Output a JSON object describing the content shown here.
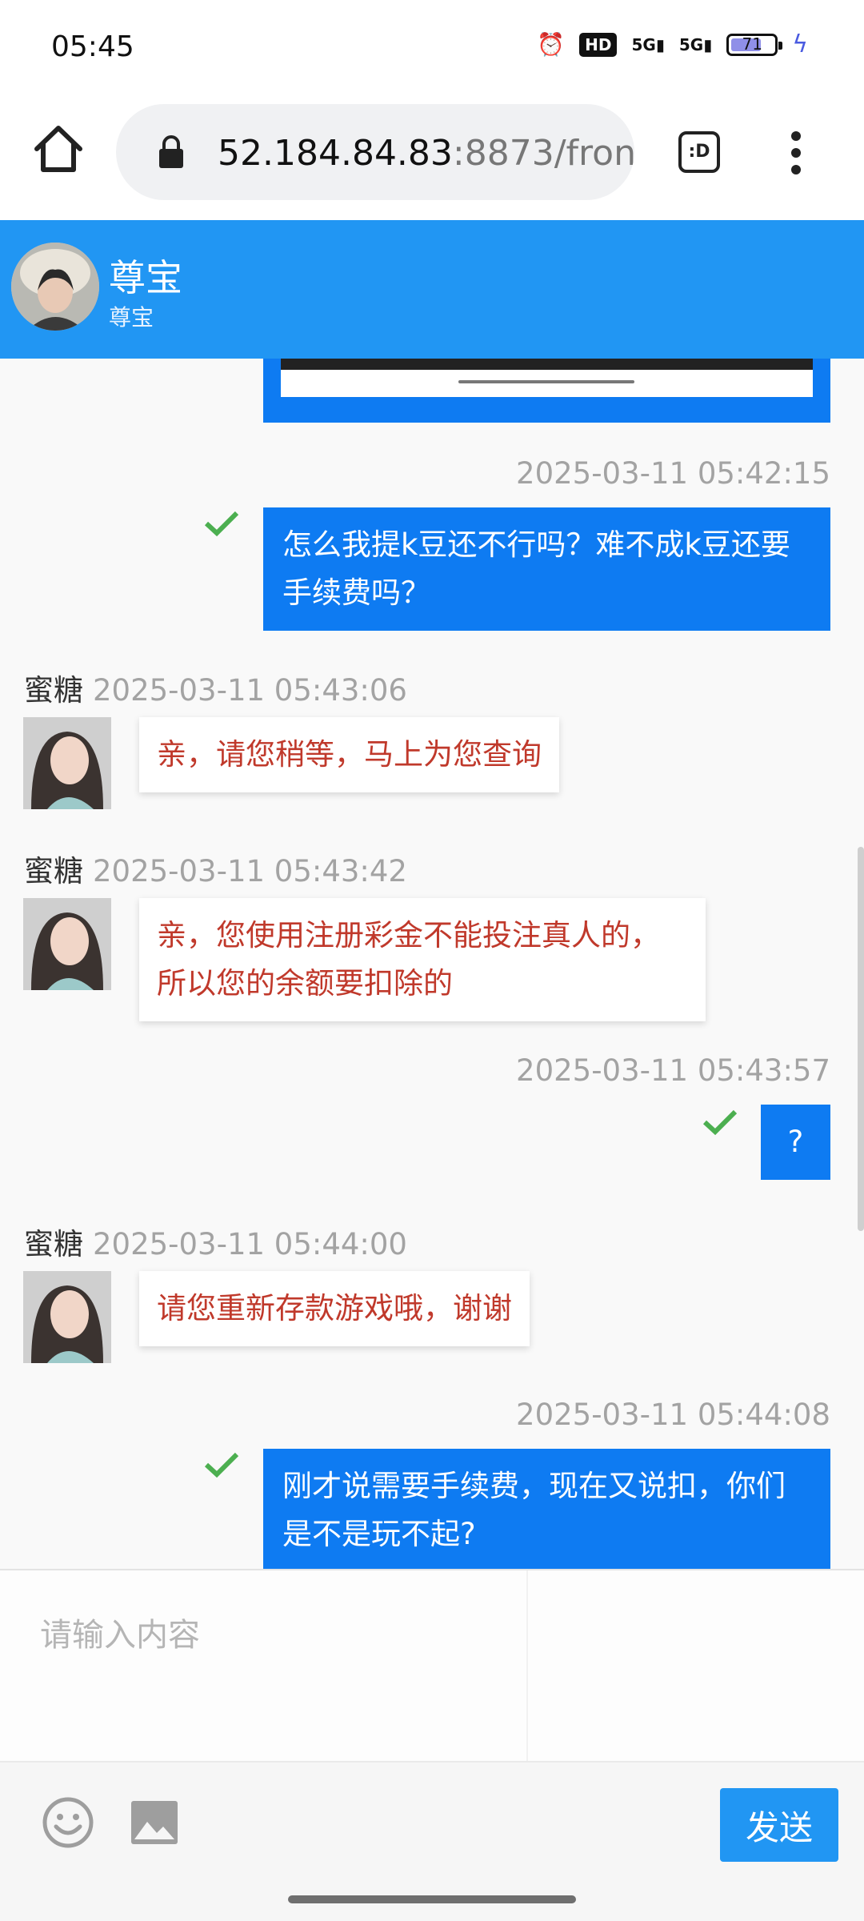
{
  "status_bar": {
    "time": "05:45",
    "hd": "HD",
    "net1": "5G",
    "net2": "5G",
    "battery": 71
  },
  "browser": {
    "url_host": "52.184.84.83",
    "url_rest": ":8873/fron",
    "tab_label": ":D"
  },
  "chat_header": {
    "name": "尊宝",
    "subtitle": "尊宝"
  },
  "messages": [
    {
      "side": "right",
      "timestamp": "2025-03-11 05:42:15",
      "text": "怎么我提k豆还不行吗？难不成k豆还要手续费吗？"
    },
    {
      "side": "left",
      "sender": "蜜糖",
      "timestamp": "2025-03-11 05:43:06",
      "text": "亲，请您稍等，马上为您查询"
    },
    {
      "side": "left",
      "sender": "蜜糖",
      "timestamp": "2025-03-11 05:43:42",
      "text": "亲，您使用注册彩金不能投注真人的，所以您的余额要扣除的"
    },
    {
      "side": "right",
      "timestamp": "2025-03-11 05:43:57",
      "text": "?"
    },
    {
      "side": "left",
      "sender": "蜜糖",
      "timestamp": "2025-03-11 05:44:00",
      "text": "请您重新存款游戏哦，谢谢"
    },
    {
      "side": "right",
      "timestamp": "2025-03-11 05:44:08",
      "text": "刚才说需要手续费，现在又说扣，你们是不是玩不起?"
    }
  ],
  "composer": {
    "placeholder": "请输入内容",
    "send_label": "发送"
  },
  "colors": {
    "header": "#2196f3",
    "bubble_right": "#0e7bf2",
    "bubble_left_text": "#c0392b",
    "tick": "#4caf50"
  }
}
